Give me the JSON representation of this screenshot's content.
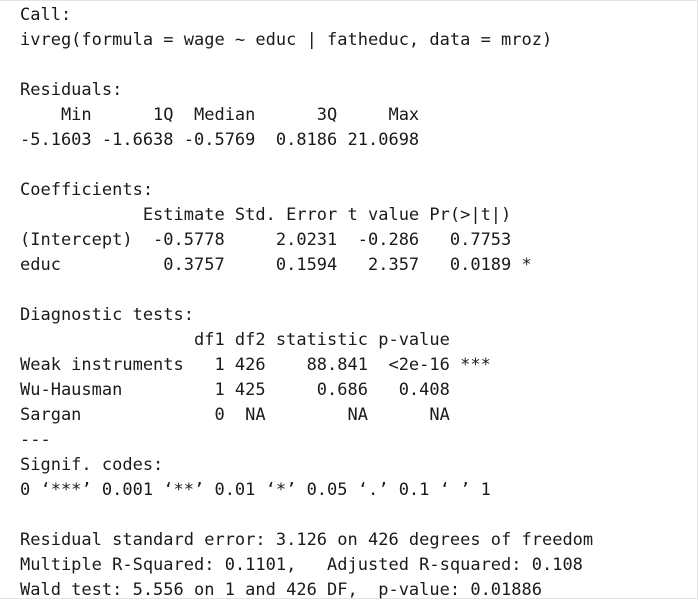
{
  "console": {
    "call_heading": "Call:",
    "call_text": "ivreg(formula = wage ~ educ | fatheduc, data = mroz)",
    "residuals_heading": "Residuals:",
    "residuals_header": "    Min      1Q  Median      3Q     Max",
    "residuals_values": "-5.1603 -1.6638 -0.5769  0.8186 21.0698",
    "coefficients_heading": "Coefficients:",
    "coefficients_header": "            Estimate Std. Error t value Pr(>|t|)",
    "coefficient_rows": [
      "(Intercept)  -0.5778     2.0231  -0.286   0.7753",
      "educ          0.3757     0.1594   2.357   0.0189 *"
    ],
    "diagnostic_heading": "Diagnostic tests:",
    "diagnostic_header": "                 df1 df2 statistic p-value",
    "diagnostic_rows": [
      "Weak instruments   1 426    88.841  <2e-16 ***",
      "Wu-Hausman         1 425     0.686   0.408",
      "Sargan             0  NA        NA      NA"
    ],
    "separator": "---",
    "signif_heading": "Signif. codes:",
    "signif_legend": "0 ‘***’ 0.001 ‘**’ 0.01 ‘*’ 0.05 ‘.’ 0.1 ‘ ’ 1",
    "residual_se": "Residual standard error: 3.126 on 426 degrees of freedom",
    "r_squared": "Multiple R-Squared: 0.1101,\tAdjusted R-squared: 0.108",
    "wald_test": "Wald test: 5.556 on 1 and 426 DF,  p-value: 0.01886"
  }
}
